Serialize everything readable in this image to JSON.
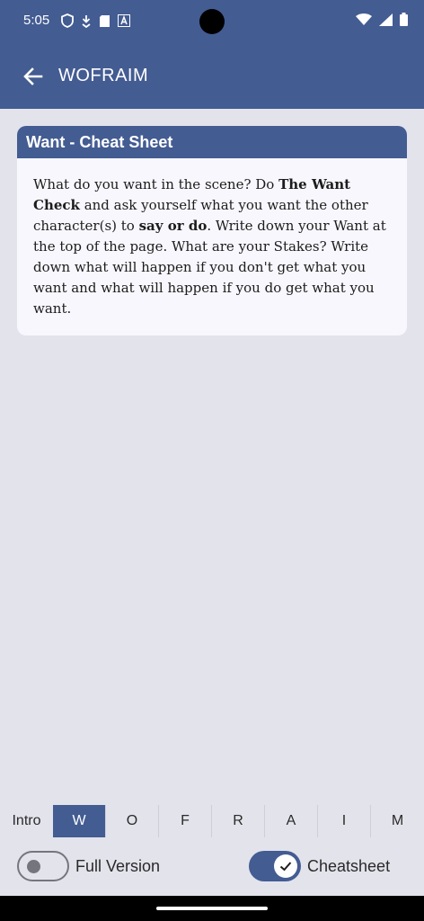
{
  "status": {
    "time": "5:05"
  },
  "app": {
    "title": "WOFRAIM"
  },
  "card": {
    "title": "Want - Cheat Sheet",
    "t1": "What do you want in the scene? Do ",
    "b1": "The Want Check",
    "t2": " and ask yourself what you want the other character(s) to ",
    "b2": "say or do",
    "t3": ". Write down your Want at the top of the page. What are your Stakes? Write down what will happen if you don't get what you want and what will happen if you do get what you want."
  },
  "tabs": [
    "Intro",
    "W",
    "O",
    "F",
    "R",
    "A",
    "I",
    "M"
  ],
  "toggles": {
    "full_version": "Full Version",
    "cheatsheet": "Cheatsheet"
  },
  "colors": {
    "primary": "#435c92",
    "background": "#e3e3ec",
    "card": "#f8f7fd"
  }
}
